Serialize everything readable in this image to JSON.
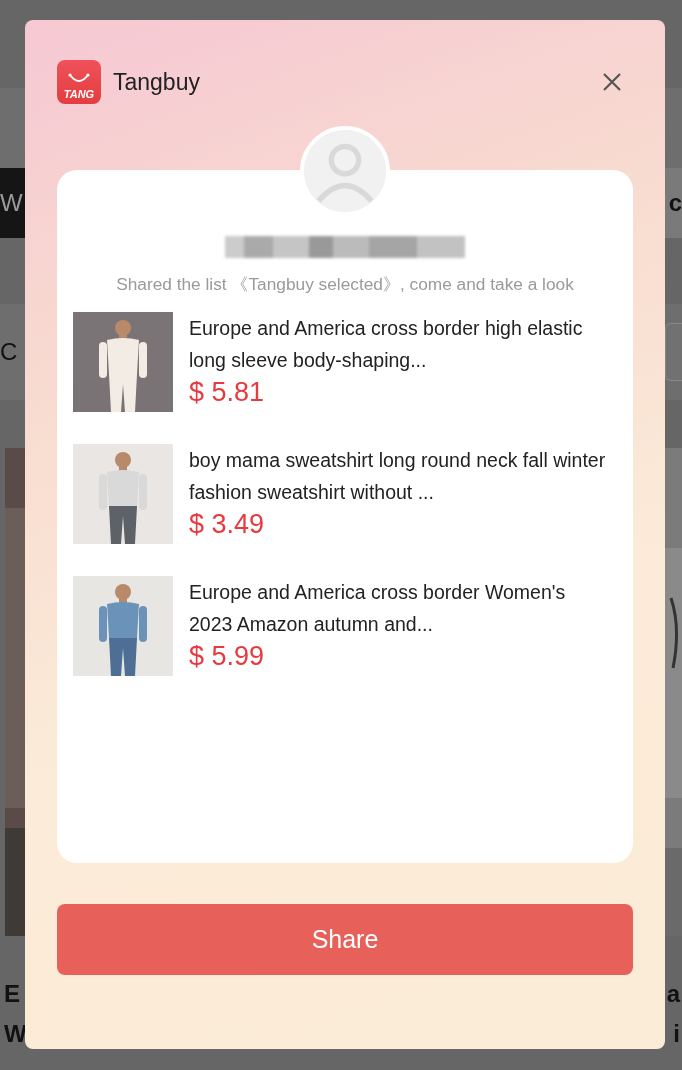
{
  "background_page": {
    "left_tab": "W",
    "right_tab": "c",
    "left_label": "C",
    "left_title_lines": [
      "E",
      "W"
    ],
    "right_title_lines": [
      "a",
      "i"
    ]
  },
  "modal": {
    "brand": {
      "logo_text": "TANG",
      "name": "Tangbuy"
    },
    "share_text": "Shared the list 《Tangbuy selected》, come and take a look",
    "products": [
      {
        "title": "Europe and America cross border high elastic long sleeve body-shaping...",
        "price": "$ 5.81"
      },
      {
        "title": "boy mama sweatshirt long round neck fall winter fashion sweatshirt without ...",
        "price": "$ 3.49"
      },
      {
        "title": "Europe and America cross border Women's 2023 Amazon autumn and...",
        "price": "$ 5.99"
      }
    ],
    "share_button": "Share"
  }
}
